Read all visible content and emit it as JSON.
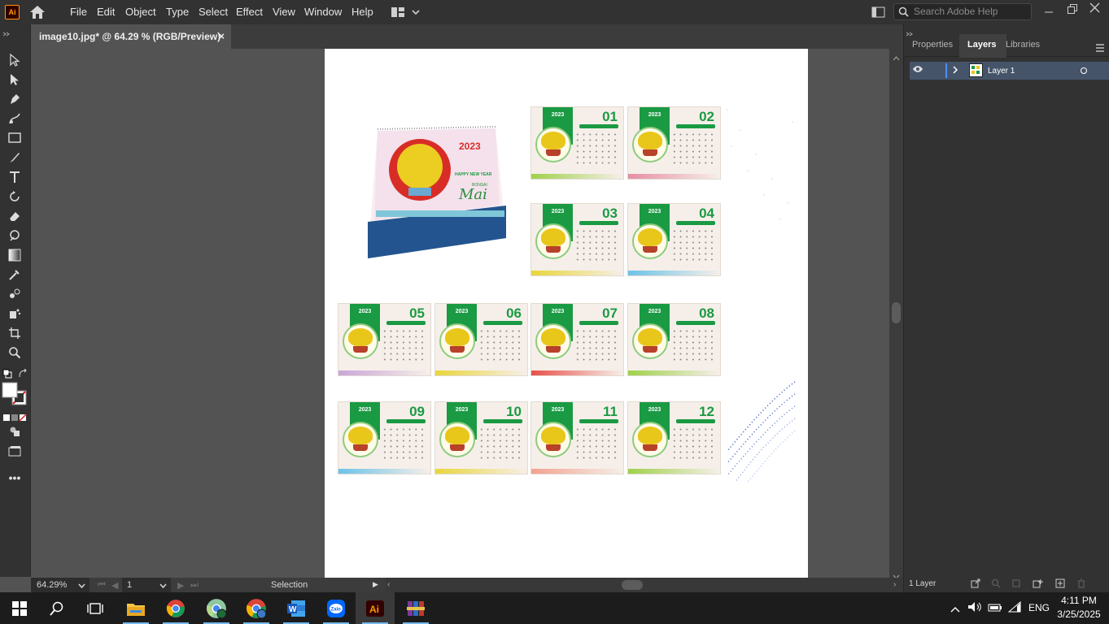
{
  "app": {
    "logo_text": "Ai",
    "menu": [
      "File",
      "Edit",
      "Object",
      "Type",
      "Select",
      "Effect",
      "View",
      "Window",
      "Help"
    ],
    "search_placeholder": "Search Adobe Help"
  },
  "document": {
    "tab_title": "image10.jpg* @ 64.29 % (RGB/Preview)",
    "close_glyph": "×"
  },
  "status": {
    "zoom": "64.29%",
    "artboard_number": "1",
    "tool": "Selection"
  },
  "panel": {
    "tabs": [
      "Properties",
      "Layers",
      "Libraries"
    ],
    "active_tab": "Layers",
    "layers": [
      {
        "name": "Layer 1"
      }
    ],
    "layer_count": "1 Layer"
  },
  "artwork": {
    "desk_calendar": {
      "year": "2023",
      "greeting": "HAPPY NEW YEAR",
      "script_title": "Mai",
      "subtitle": "BONSAI"
    },
    "calendar_year": "2023",
    "months": [
      "01",
      "02",
      "03",
      "04",
      "05",
      "06",
      "07",
      "08",
      "09",
      "10",
      "11",
      "12"
    ],
    "accent_colors": [
      "#1a9a43",
      "#e9c61a",
      "#b7412a",
      "#9fd14a",
      "#6cc3e8",
      "#e58fa4"
    ]
  },
  "taskbar": {
    "apps": [
      "start-button",
      "search",
      "task-view",
      "file-explorer",
      "chrome",
      "chrome-profile-2",
      "chrome-profile-3",
      "word",
      "zalo",
      "illustrator",
      "winrar"
    ],
    "tray": {
      "language": "ENG",
      "time": "4:11 PM",
      "date": "3/25/2025"
    }
  }
}
